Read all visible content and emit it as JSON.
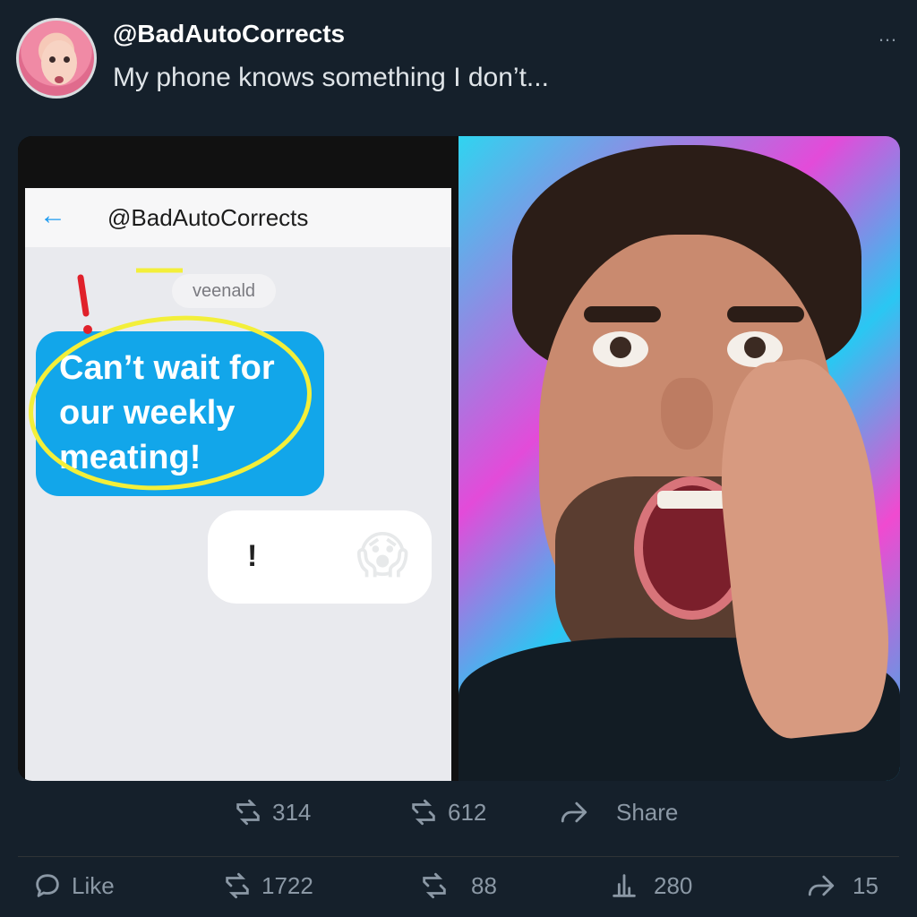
{
  "post": {
    "handle": "@BadAutoCorrects",
    "text": "My phone knows something I don’t...",
    "more_icon": "…"
  },
  "phone": {
    "title": "@BadAutoCorrects",
    "timestamp": "veenald",
    "sent_message": "Can’t wait for our weekly meating!",
    "reply_text": "!",
    "reply_emoji": "😱"
  },
  "actions_row1": [
    {
      "icon": "retweet-icon",
      "count": "314"
    },
    {
      "icon": "retweet-icon",
      "count": "612"
    },
    {
      "icon": "share-icon",
      "label": "Share"
    }
  ],
  "actions_row2": [
    {
      "icon": "comment-icon",
      "label": "Like"
    },
    {
      "icon": "retweet-icon",
      "count": "1722"
    },
    {
      "icon": "retweet-icon",
      "count": "88"
    },
    {
      "icon": "views-icon",
      "count": "280"
    },
    {
      "icon": "share-icon",
      "count": "15"
    }
  ],
  "colors": {
    "background": "#15202b",
    "accent_blue": "#1d9bf0",
    "highlight_yellow": "#f3ef3a",
    "alert_red": "#e0212b"
  }
}
